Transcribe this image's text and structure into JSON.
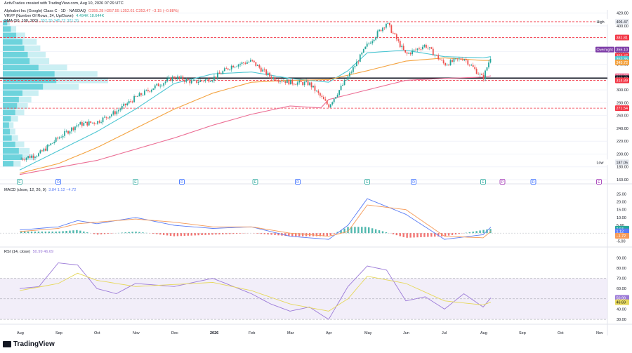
{
  "header": {
    "created_by": "ActivTrades created with TradingView.com, Aug 10, 2026 07:29 UTC",
    "symbol": "Alphabet Inc (Google) Class C · 1D · NASDAQ",
    "ohlc": "O355.28 H357.55 L352.61 C353.47 −3.15 (−0.88%)",
    "vrvp_label": "VRVP (Number Of Rows, 24, Up/Down)",
    "vrvp_values": "4.494K   18.644K",
    "sma_label": "SMA (50, 100, 200)",
    "sma_values": "352.35  345.72  321.35",
    "macd_label": "MACD (close, 12, 26, 9)",
    "macd_values": "3.84  1.12  −4.72",
    "rsi_label": "RSI (14, close)",
    "rsi_values": "50.99  46.69"
  },
  "colors": {
    "up": "#26a69a",
    "down": "#ef5350",
    "sma50": "#4dc6d2",
    "sma100": "#f4a340",
    "sma200": "#ec6f95",
    "macd": "#5b7df5",
    "signal": "#f59a58",
    "rsi": "#9c7bd8",
    "rsi_ma": "#e6d85c",
    "rsi_band": "#ede7f6",
    "vp": "#54cbd6"
  },
  "watermark": "TradingView",
  "chart_data": [
    {
      "type": "candlestick",
      "title": "Alphabet Inc (Google) Class C · 1D · NASDAQ",
      "x_ticks": [
        "Aug",
        "Sep",
        "Oct",
        "Nov",
        "Dec",
        "2026",
        "Feb",
        "Mar",
        "Apr",
        "May",
        "Jun",
        "Jul",
        "Aug",
        "Sep",
        "Oct",
        "Nov"
      ],
      "y_ticks": [
        160,
        180,
        200,
        220,
        240,
        260,
        280,
        300,
        320,
        340,
        360,
        380,
        400,
        420
      ],
      "ylim": [
        160,
        425
      ],
      "series": [
        {
          "name": "price",
          "x_months": [
            0,
            0.5,
            1,
            1.5,
            2,
            2.5,
            3,
            3.5,
            4,
            4.5,
            5,
            5.5,
            6,
            6.5,
            7,
            7.5,
            8,
            8.5,
            9,
            9.5,
            10,
            10.5,
            11,
            11.5,
            12,
            12.2
          ],
          "values": [
            192,
            200,
            225,
            246,
            250,
            266,
            288,
            305,
            320,
            312,
            318,
            338,
            345,
            320,
            312,
            310,
            275,
            320,
            370,
            405,
            355,
            370,
            340,
            350,
            318,
            353
          ]
        },
        {
          "name": "SMA 50",
          "x_months": [
            0,
            1,
            2,
            3,
            4,
            5,
            6,
            7,
            8,
            8.5,
            9,
            10,
            11,
            12,
            12.2
          ],
          "values": [
            175,
            205,
            235,
            270,
            310,
            325,
            328,
            318,
            312,
            330,
            358,
            362,
            352,
            350,
            352
          ]
        },
        {
          "name": "SMA 100",
          "x_months": [
            0,
            1,
            2,
            3,
            4,
            5,
            6,
            7,
            8,
            9,
            10,
            11,
            12,
            12.2
          ],
          "values": [
            170,
            185,
            210,
            240,
            270,
            295,
            312,
            315,
            316,
            330,
            345,
            350,
            346,
            346
          ]
        },
        {
          "name": "SMA 200",
          "x_months": [
            0,
            2,
            4,
            5,
            6,
            7,
            7.8,
            8,
            9,
            10,
            11,
            12,
            12.2
          ],
          "values": [
            168,
            190,
            225,
            245,
            262,
            275,
            272,
            285,
            300,
            315,
            318,
            320,
            322
          ]
        }
      ],
      "price_labels": [
        {
          "text": "High",
          "value": 406.47,
          "color": "#ffffff",
          "text_color": "#131722"
        },
        {
          "text": "406.47",
          "value": 406.47,
          "color": "#e8ebf1",
          "text_color": "#131722"
        },
        {
          "text": "381.81",
          "value": 381.81,
          "color": "#f23645",
          "text_color": "#ffffff"
        },
        {
          "text": "Overnight",
          "value": 363,
          "color": "#7e3da8",
          "text_color": "#ffffff"
        },
        {
          "text": "355.10",
          "value": 363,
          "color": "#7e3da8",
          "text_color": "#ffffff"
        },
        {
          "text": "353.47",
          "value": 353.47,
          "color": "#f23645",
          "text_color": "#ffffff"
        },
        {
          "text": "352.35",
          "value": 348.5,
          "color": "#4dc6d2",
          "text_color": "#ffffff"
        },
        {
          "text": "345.72",
          "value": 343,
          "color": "#f4a340",
          "text_color": "#ffffff"
        },
        {
          "text": "321.35",
          "value": 321.35,
          "color": "#ec6f95",
          "text_color": "#ffffff"
        },
        {
          "text": "318.42",
          "value": 318.42,
          "color": "#131722",
          "text_color": "#ffffff"
        },
        {
          "text": "314.89",
          "value": 314.89,
          "color": "#f23645",
          "text_color": "#ffffff"
        },
        {
          "text": "271.54",
          "value": 271.54,
          "color": "#f23645",
          "text_color": "#ffffff"
        },
        {
          "text": "Low",
          "value": 187.05,
          "color": "#ffffff",
          "text_color": "#131722"
        },
        {
          "text": "187.05",
          "value": 187.05,
          "color": "#e8ebf1",
          "text_color": "#131722"
        }
      ],
      "horizontal_lines": [
        {
          "value": 318.42,
          "color": "#131722",
          "style": "solid"
        },
        {
          "value": 406.47,
          "color": "#f23645",
          "style": "dashed"
        },
        {
          "value": 381.81,
          "color": "#f23645",
          "style": "dashed"
        },
        {
          "value": 314.89,
          "color": "#f23645",
          "style": "dashed"
        },
        {
          "value": 271.54,
          "color": "#f23645",
          "style": "dashed"
        }
      ],
      "event_markers": [
        {
          "month": 0,
          "text": "E",
          "color": "#26a69a"
        },
        {
          "month": 1,
          "text": "D",
          "color": "#2962ff"
        },
        {
          "month": 3,
          "text": "E",
          "color": "#26a69a"
        },
        {
          "month": 4.2,
          "text": "D",
          "color": "#2962ff"
        },
        {
          "month": 6.1,
          "text": "E",
          "color": "#26a69a"
        },
        {
          "month": 7.2,
          "text": "D",
          "color": "#2962ff"
        },
        {
          "month": 9,
          "text": "E",
          "color": "#26a69a"
        },
        {
          "month": 10.2,
          "text": "D",
          "color": "#2962ff"
        },
        {
          "month": 12,
          "text": "E",
          "color": "#26a69a"
        },
        {
          "month": 12.5,
          "text": "P",
          "color": "#9c27b0"
        },
        {
          "month": 13.3,
          "text": "D",
          "color": "#2962ff"
        },
        {
          "month": 15,
          "text": "E",
          "color": "#9c27b0"
        }
      ]
    },
    {
      "type": "bar",
      "title": "VRVP (Number Of Rows, 24, Up/Down)",
      "y_price_levels": [
        185,
        195,
        205,
        215,
        225,
        235,
        245,
        255,
        265,
        275,
        285,
        295,
        305,
        315,
        325,
        335,
        345,
        355,
        365,
        375,
        385,
        395,
        405
      ],
      "up_volume": [
        12,
        22,
        18,
        14,
        10,
        8,
        7,
        9,
        14,
        16,
        18,
        22,
        45,
        60,
        58,
        40,
        30,
        28,
        24,
        22,
        15,
        9,
        5
      ],
      "down_volume": [
        8,
        14,
        12,
        10,
        7,
        6,
        5,
        8,
        10,
        12,
        14,
        18,
        40,
        58,
        48,
        32,
        22,
        20,
        18,
        16,
        10,
        6,
        3
      ]
    },
    {
      "type": "line",
      "title": "MACD (close, 12, 26, 9)",
      "y_ticks": [
        -5,
        0,
        5,
        10,
        15,
        20,
        25
      ],
      "ylim": [
        -8,
        27
      ],
      "series": [
        {
          "name": "MACD",
          "x_months": [
            0,
            1,
            1.5,
            2,
            3,
            4,
            5,
            6,
            7,
            8,
            8.5,
            9,
            10,
            11,
            12,
            12.2
          ],
          "values": [
            2,
            4,
            8,
            6,
            10,
            5,
            3,
            4,
            -2,
            -4,
            5,
            22,
            12,
            -4,
            -1,
            3.8
          ]
        },
        {
          "name": "Signal",
          "x_months": [
            0,
            1,
            1.5,
            2,
            3,
            4,
            5,
            6,
            7,
            8,
            8.5,
            9,
            10,
            11,
            12,
            12.2
          ],
          "values": [
            1,
            3,
            6,
            7,
            9,
            7,
            4,
            4,
            0,
            -2,
            1,
            18,
            15,
            -2,
            -3,
            1.1
          ]
        },
        {
          "name": "Histogram",
          "x_months": [
            0,
            1,
            1.5,
            2,
            3,
            4,
            5,
            6,
            7,
            8,
            8.5,
            9,
            10,
            11,
            12,
            12.2
          ],
          "values": [
            1,
            1,
            2,
            -1,
            1,
            -2,
            -1,
            0,
            -2,
            -2,
            4,
            4,
            -3,
            -2,
            2,
            2.7
          ]
        }
      ],
      "price_labels": [
        {
          "text": "2.84",
          "value": 2.84,
          "color": "#26a69a",
          "text_color": "#ffffff"
        },
        {
          "text": "1.12",
          "value": 1.12,
          "color": "#5b7df5",
          "text_color": "#ffffff"
        },
        {
          "text": "−1.72",
          "value": -1.72,
          "color": "#f59a58",
          "text_color": "#ffffff"
        }
      ]
    },
    {
      "type": "line",
      "title": "RSI (14, close)",
      "y_ticks": [
        30,
        40,
        50,
        60,
        70,
        80,
        90
      ],
      "ylim": [
        28,
        95
      ],
      "bands": [
        30,
        50,
        70
      ],
      "series": [
        {
          "name": "RSI",
          "x_months": [
            0,
            0.5,
            1,
            1.5,
            2,
            2.5,
            3,
            4,
            5,
            6,
            6.5,
            7,
            7.5,
            8,
            8.5,
            9,
            9.5,
            10,
            10.5,
            11,
            11.5,
            12,
            12.2
          ],
          "values": [
            60,
            62,
            85,
            83,
            60,
            55,
            65,
            62,
            70,
            55,
            45,
            38,
            42,
            30,
            62,
            82,
            78,
            48,
            52,
            40,
            55,
            42,
            51
          ]
        },
        {
          "name": "RSI MA",
          "x_months": [
            0,
            1,
            1.5,
            2,
            3,
            4,
            5,
            6,
            7,
            8,
            8.5,
            9,
            10,
            11,
            12,
            12.2
          ],
          "values": [
            58,
            65,
            75,
            68,
            62,
            64,
            66,
            58,
            45,
            38,
            50,
            72,
            65,
            48,
            44,
            46.7
          ]
        }
      ],
      "price_labels": [
        {
          "text": "50.99",
          "value": 50.99,
          "color": "#9c7bd8",
          "text_color": "#ffffff"
        },
        {
          "text": "46.69",
          "value": 46.69,
          "color": "#e6d85c",
          "text_color": "#131722"
        }
      ]
    }
  ]
}
